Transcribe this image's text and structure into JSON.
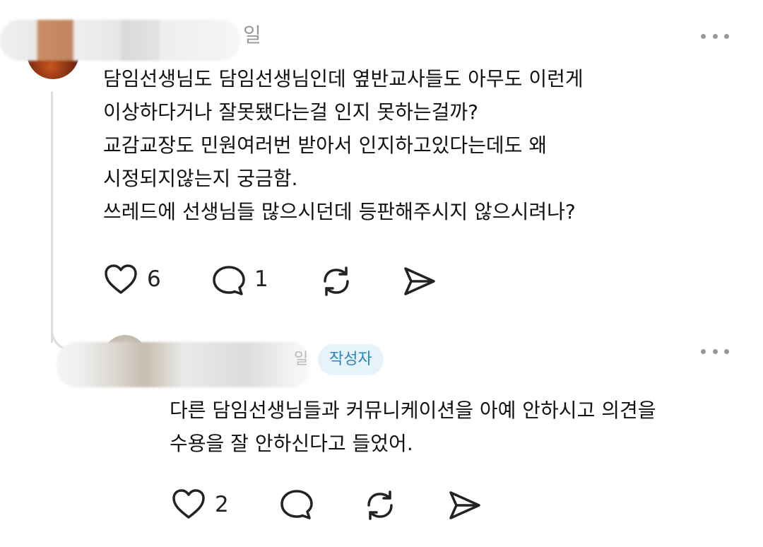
{
  "post": {
    "time_suffix": "일",
    "lines": [
      "담임선생님도 담임선생님인데 옆반교사들도 아무도 이런게",
      "이상하다거나 잘못됐다는걸 인지 못하는걸까?",
      "교감교장도 민원여러번 받아서 인지하고있다는데도 왜",
      "시정되지않는지 궁금함.",
      "쓰레드에 선생님들 많으시던데 등판해주시지 않으시려나?"
    ],
    "likes": "6",
    "replies": "1"
  },
  "reply": {
    "time_suffix": "일",
    "author_badge": "작성자",
    "lines": [
      "다른 담임선생님들과 커뮤니케이션을 아예 안하시고 의견을",
      "수용을 잘 안하신다고 들었어."
    ],
    "likes": "2"
  },
  "icons": {
    "like": "heart-icon",
    "reply": "comment-icon",
    "repost": "repost-icon",
    "share": "send-icon",
    "more": "more-dots-icon"
  },
  "colors": {
    "badge_bg": "#e6f3fb",
    "badge_text": "#2a86bb",
    "muted": "#999999",
    "icon": "#222222"
  }
}
